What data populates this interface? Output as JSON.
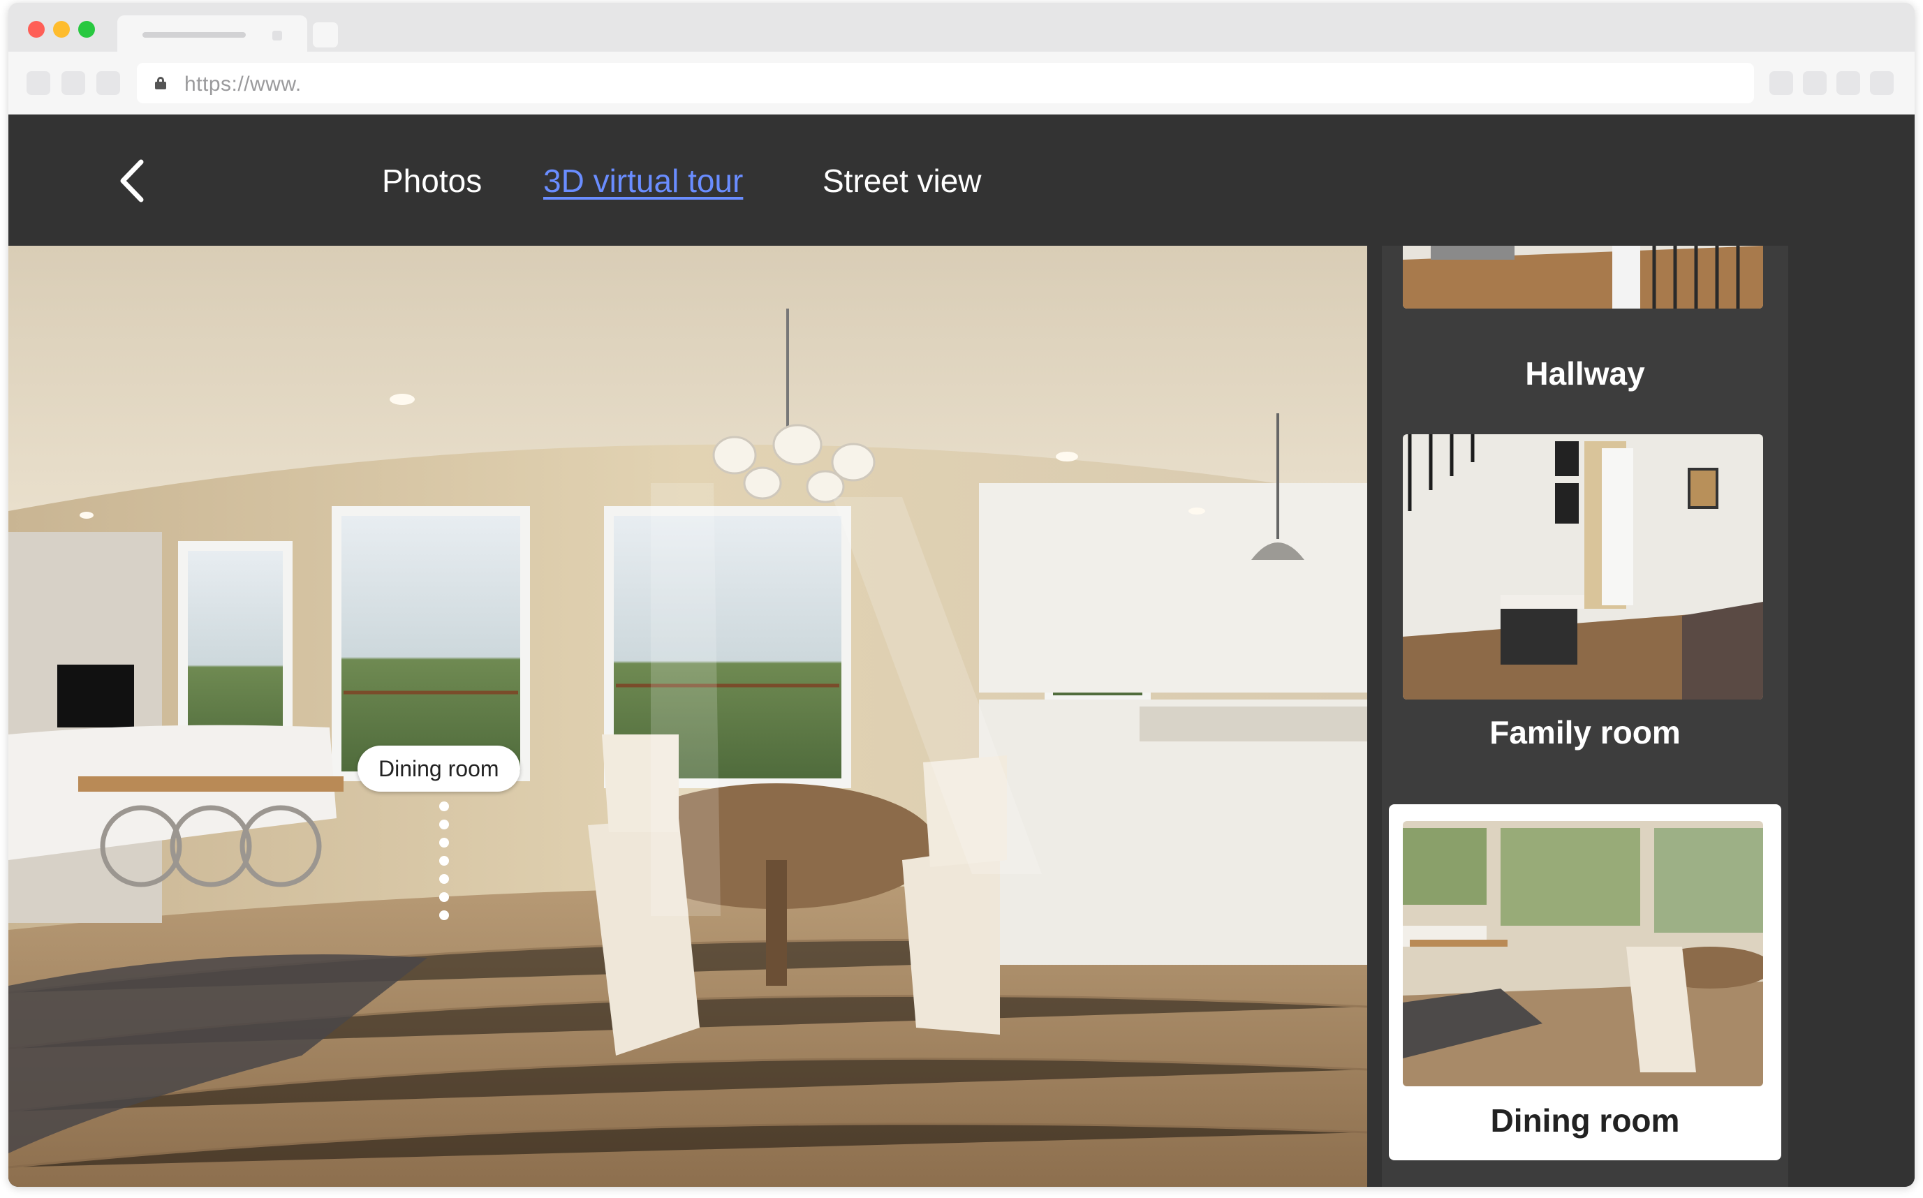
{
  "browser": {
    "url": "https://www."
  },
  "header": {
    "tabs": [
      {
        "label": "Photos",
        "active": false
      },
      {
        "label": "3D virtual tour",
        "active": true
      },
      {
        "label": "Street view",
        "active": false
      }
    ],
    "active_color": "#6a8dff"
  },
  "viewer": {
    "hotspot_label": "Dining room"
  },
  "sidebar": {
    "rooms": [
      {
        "label": "Hallway",
        "selected": false
      },
      {
        "label": "Family room",
        "selected": false
      },
      {
        "label": "Dining room",
        "selected": true
      }
    ]
  }
}
